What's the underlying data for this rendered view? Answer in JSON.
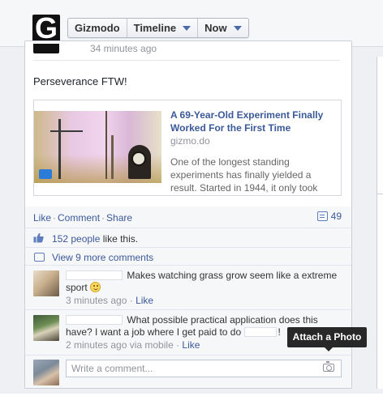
{
  "header": {
    "page_name": "Gizmodo",
    "logo_letter": "G",
    "timeline_label": "Timeline",
    "now_label": "Now"
  },
  "post": {
    "time_ago": "34 minutes ago",
    "text": "Perseverance FTW!",
    "link": {
      "title": "A 69-Year-Old Experiment Finally Worked For the First Time",
      "domain": "gizmo.do",
      "description": "One of the longest standing experiments has finally yielded a result. Started in 1944, it only took"
    }
  },
  "feedback": {
    "like_label": "Like",
    "comment_label": "Comment",
    "share_label": "Share",
    "comment_count": "49",
    "likes_people": "152 people",
    "likes_suffix": "like this.",
    "view_more": "View 9 more comments"
  },
  "comments": [
    {
      "text": "Makes watching grass grow seem like a extreme sport",
      "time": "3 minutes ago",
      "like_label": "Like"
    },
    {
      "text_before": "What possible practical application does this have? I want a job where I get paid to do",
      "text_after": "!",
      "time": "2 minutes ago via mobile",
      "like_label": "Like"
    }
  ],
  "composer": {
    "placeholder": "Write a comment...",
    "tooltip": "Attach a Photo"
  },
  "colors": {
    "link_blue": "#3b5998",
    "feedback_bg": "#f6f7f9",
    "tooltip_bg": "#282828"
  },
  "icons": [
    "gizmodo-logo",
    "caret-down-icon",
    "comment-count-icon",
    "like-thumb-icon",
    "comments-icon",
    "smiley-icon",
    "camera-icon"
  ]
}
